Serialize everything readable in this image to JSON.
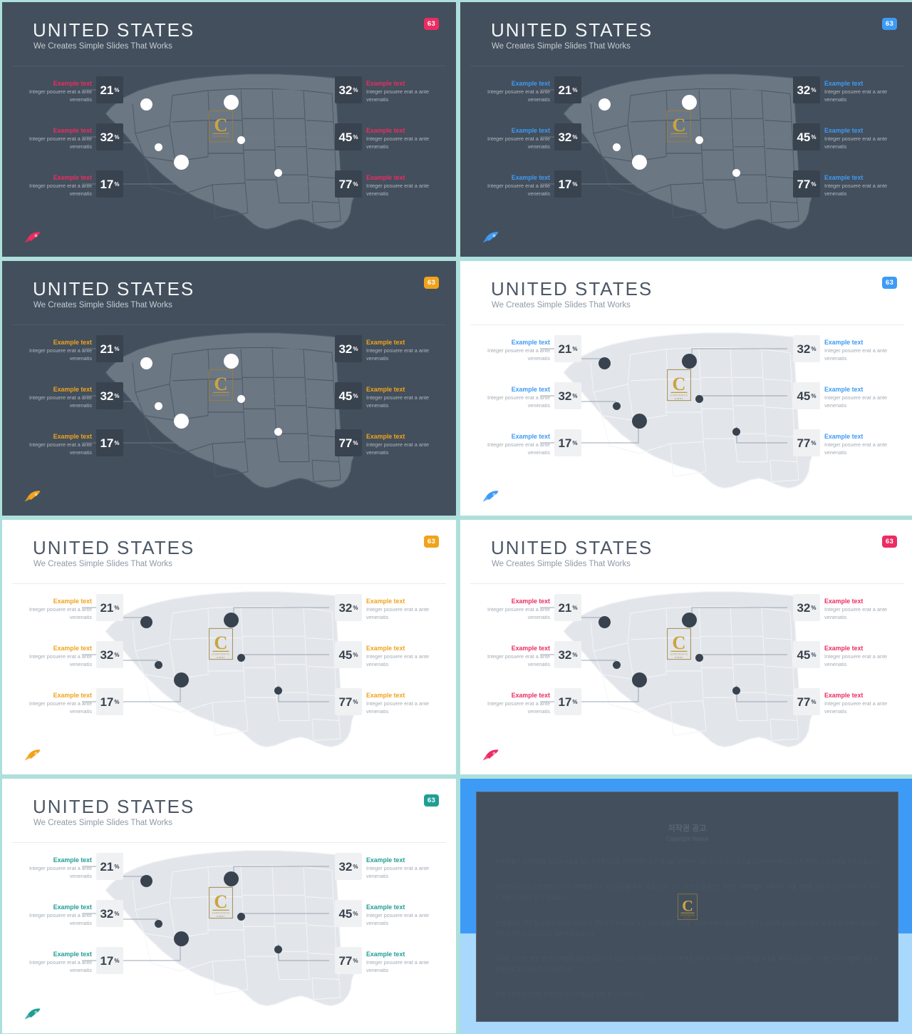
{
  "meta": {
    "canvas_bg": "#ade0dc",
    "dark_bg": "#434f5c",
    "light_bg": "#ffffff"
  },
  "slide_common": {
    "title": "UNITED STATES",
    "subtitle": "We Creates Simple Slides That Works",
    "badge": "63",
    "logo_letter": "C",
    "logo_word": "CONTENTS",
    "logo_sub": "FIRST",
    "stats": [
      {
        "side": "left",
        "row": 1,
        "heading": "Example text",
        "body": "Integer posuere erat a ante venenatis",
        "value": "21",
        "unit": "%"
      },
      {
        "side": "left",
        "row": 2,
        "heading": "Example text",
        "body": "Integer posuere erat a ante venenatis",
        "value": "32",
        "unit": "%"
      },
      {
        "side": "left",
        "row": 3,
        "heading": "Example text",
        "body": "Integer posuere erat a ante venenatis",
        "value": "17",
        "unit": "%"
      },
      {
        "side": "right",
        "row": 1,
        "heading": "Example text",
        "body": "Integer posuere erat a ante venenatis",
        "value": "32",
        "unit": "%"
      },
      {
        "side": "right",
        "row": 2,
        "heading": "Example text",
        "body": "Integer posuere erat a ante venenatis",
        "value": "45",
        "unit": "%"
      },
      {
        "side": "right",
        "row": 3,
        "heading": "Example text",
        "body": "Integer posuere erat a ante venenatis",
        "value": "77",
        "unit": "%"
      }
    ]
  },
  "slides": [
    {
      "index": 1,
      "theme": "dark",
      "accent": "#ec2c62",
      "badge_color": "#ec2c62",
      "rocket_color": "#ec2c62",
      "map_fill": "#6c7784",
      "map_stroke": "#4d5966"
    },
    {
      "index": 2,
      "theme": "dark",
      "accent": "#3e9bf5",
      "badge_color": "#3e9bf5",
      "rocket_color": "#3e9bf5",
      "map_fill": "#6c7784",
      "map_stroke": "#4d5966"
    },
    {
      "index": 3,
      "theme": "dark",
      "accent": "#f0a31c",
      "badge_color": "#f0a31c",
      "rocket_color": "#f0a31c",
      "map_fill": "#6c7784",
      "map_stroke": "#4d5966"
    },
    {
      "index": 4,
      "theme": "light",
      "accent": "#3e9bf5",
      "badge_color": "#3e9bf5",
      "rocket_color": "#3e9bf5",
      "map_fill": "#e2e5ea",
      "map_stroke": "#f3f5f7"
    },
    {
      "index": 5,
      "theme": "light",
      "accent": "#f0a31c",
      "badge_color": "#f0a31c",
      "rocket_color": "#f0a31c",
      "map_fill": "#e2e5ea",
      "map_stroke": "#f3f5f7"
    },
    {
      "index": 6,
      "theme": "light",
      "accent": "#ec2c62",
      "badge_color": "#ec2c62",
      "rocket_color": "#ec2c62",
      "map_fill": "#e2e5ea",
      "map_stroke": "#f3f5f7"
    },
    {
      "index": 7,
      "theme": "light",
      "accent": "#1f9e94",
      "badge_color": "#1f9e94",
      "rocket_color": "#1f9e94",
      "map_fill": "#e2e5ea",
      "map_stroke": "#f3f5f7"
    }
  ],
  "copyright_slide": {
    "title": "저작권 공고",
    "subtitle": "Copyright Notice",
    "paragraphs": [
      "본 저작물은 저작권법에 의하여 보호를 받는 저작물이므로 무단 전재와 무단 복제를 금지하며, 내용의 전부 또는 일부를 이용하려면 반드시 저작권자의 서면 동의를 받아야 합니다.",
      "저작권자의 사전 서면 동의 없이 본 저작물의 전부 또는 일부를 복제, 배포, 전송, 전시, 공연 및 방송하는 행위는 저작권법에 저촉되며, 이를 위반할 경우 민사상 손해배상 및 형사상 처벌의 대상이 될 수 있습니다.",
      "본 템플릿은 개인 및 상업적 용도로 자유롭게 편집하여 사용하실 수 있으나, 템플릿 자체를 재판매하거나 재배포하는 행위는 엄격히 금지됩니다. 무료 및 유료 회원에게 제공되는 모든 디자인 소스의 권리는 제작사에 있습니다.",
      "이미지, 아이콘, 폰트 등 본 저작물에 포함된 모든 구성 요소는 각 권리자의 라이선스 정책을 따르며, 사용자는 해당 정책을 준수할 책임이 있습니다. 상세한 내용은 홈페이지의 이용약관을 참고하여 주시기 바랍니다.",
      "문의 사항이 있으시면 고객센터 또는 이메일로 연락 주시기 바랍니다."
    ],
    "logo_letter": "C",
    "card_bg": "#434f5c",
    "top_bg": "#3e9bf5",
    "bottom_bg": "#a8d8fb"
  }
}
